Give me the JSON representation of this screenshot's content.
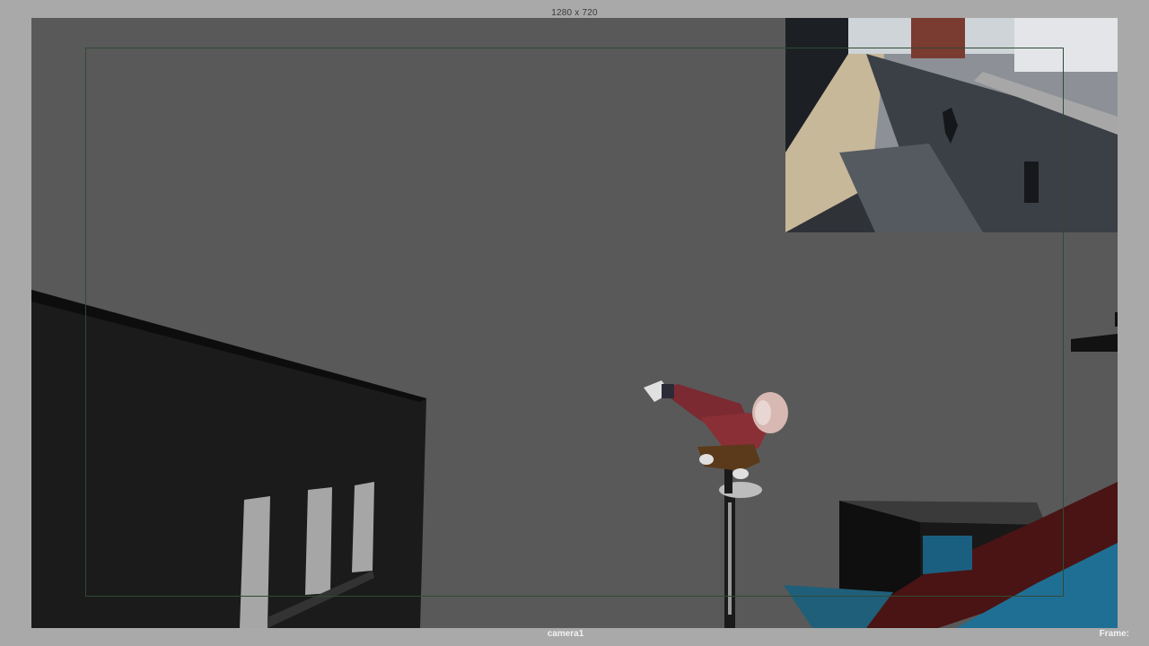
{
  "viewport": {
    "resolution_label": "1280 x 720",
    "camera_label": "camera1",
    "frame_label": "Frame:"
  },
  "colors": {
    "background_frame": "#a9a9a9",
    "viewport_bg": "#595959",
    "resolution_gate": "#2f4b35",
    "building": "#1a1a1a",
    "window": "#a6a6a6",
    "character_jacket": "#7a2a30",
    "character_pants": "#5a3a1a",
    "ramp_red": "#4a1414",
    "ramp_blue": "#1f6f94"
  },
  "scene": {
    "objects": [
      "building",
      "windows",
      "character",
      "lamp-post",
      "ramp",
      "reference-plate"
    ]
  }
}
